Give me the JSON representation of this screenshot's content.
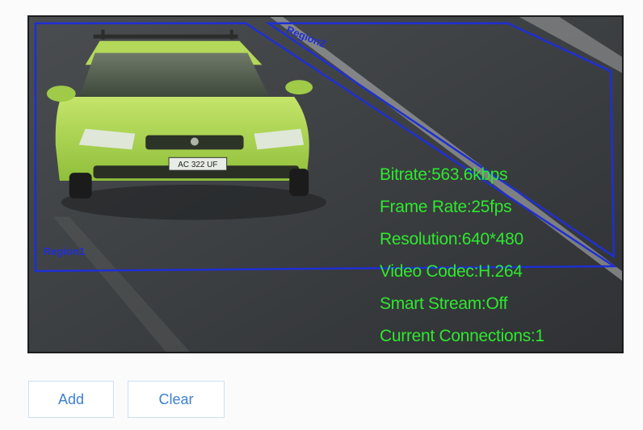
{
  "video": {
    "osd_lines": {
      "bitrate": "Bitrate:563.6kbps",
      "frame_rate": "Frame Rate:25fps",
      "resolution": "Resolution:640*480",
      "video_codec": "Video Codec:H.264",
      "smart_stream": "Smart Stream:Off",
      "current_connections": "Current Connections:1"
    },
    "regions": {
      "region1_label": "Region1",
      "region2_label": "Region2"
    },
    "plate_text": "AC 322 UF",
    "colors": {
      "osd_text": "#2ee82e",
      "region_outline": "#1f2fd4",
      "car_body": "#a6d64a"
    }
  },
  "actions": {
    "add_label": "Add",
    "clear_label": "Clear"
  }
}
